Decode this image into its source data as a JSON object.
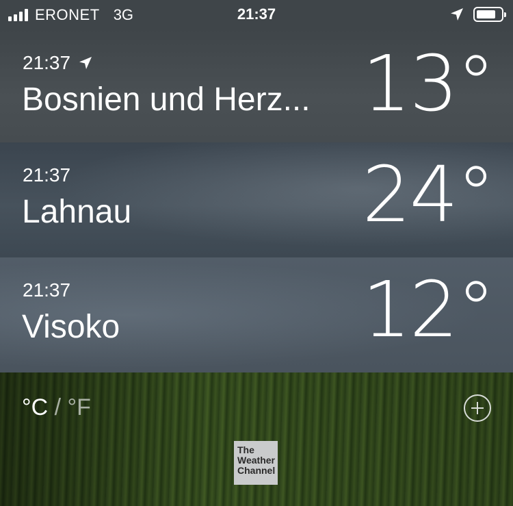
{
  "status_bar": {
    "carrier": "ERONET",
    "network": "3G",
    "time": "21:37",
    "battery_level": 0.8
  },
  "locations": [
    {
      "time": "21:37",
      "current_location": true,
      "name": "Bosnien und Herz...",
      "temp": "13°"
    },
    {
      "time": "21:37",
      "current_location": false,
      "name": "Lahnau",
      "temp": "24°"
    },
    {
      "time": "21:37",
      "current_location": false,
      "name": "Visoko",
      "temp": "12°"
    }
  ],
  "footer": {
    "unit_c": "°C",
    "unit_sep": "/",
    "unit_f": "°F",
    "logo_lines": [
      "The",
      "Weather",
      "Channel"
    ]
  },
  "icons": [
    "location-arrow-icon",
    "signal-icon",
    "battery-icon",
    "add-location-icon"
  ]
}
